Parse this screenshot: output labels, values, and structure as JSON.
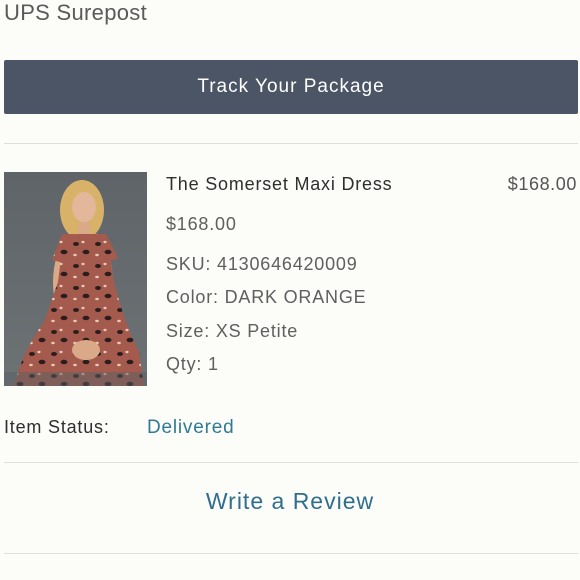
{
  "shipping": {
    "carrier": "UPS Surepost",
    "track_label": "Track Your Package"
  },
  "item": {
    "name": "The Somerset Maxi Dress",
    "line_total": "$168.00",
    "unit_price": "$168.00",
    "sku": "SKU: 4130646420009",
    "color": "Color: DARK ORANGE",
    "size": "Size: XS Petite",
    "qty": "Qty: 1",
    "image_icon": "product-photo"
  },
  "status": {
    "label": "Item Status:",
    "value": "Delivered"
  },
  "review": {
    "label": "Write a Review"
  },
  "colors": {
    "button_bg": "#4b5566",
    "status_link": "#2f7a93",
    "review_link": "#2f6f8d",
    "dress_primary": "#a45a4c"
  }
}
